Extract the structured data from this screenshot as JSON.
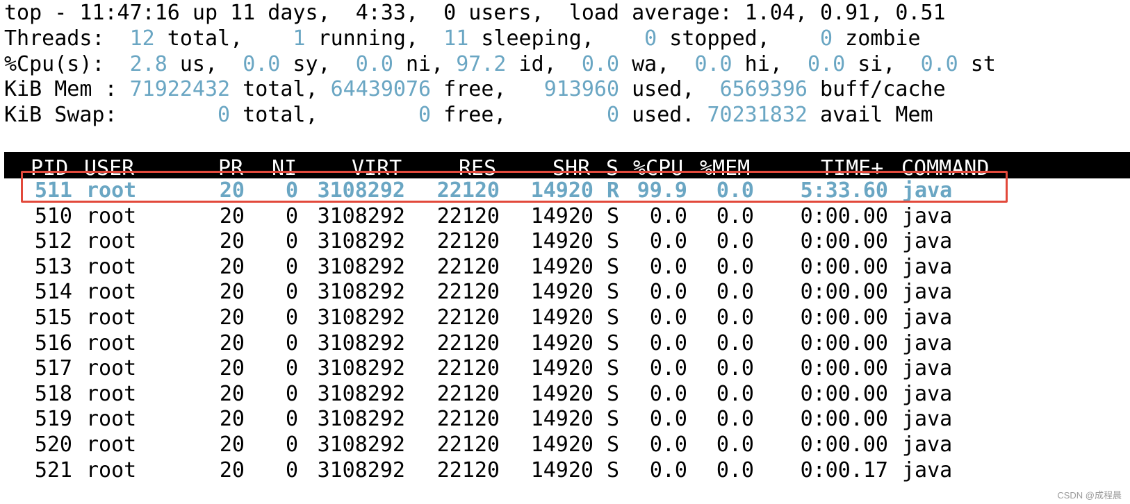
{
  "summary": {
    "top": "top - 11:47:16 up 11 days,  4:33,  0 users,  load average: 1.04, 0.91, 0.51",
    "threads": [
      {
        "t": "Threads: ",
        "c": false
      },
      {
        "t": " 12",
        "c": true
      },
      {
        "t": " total,  ",
        "c": false
      },
      {
        "t": "  1",
        "c": true
      },
      {
        "t": " running,  ",
        "c": false
      },
      {
        "t": "11",
        "c": true
      },
      {
        "t": " sleeping,  ",
        "c": false
      },
      {
        "t": "  0",
        "c": true
      },
      {
        "t": " stopped,  ",
        "c": false
      },
      {
        "t": "  0",
        "c": true
      },
      {
        "t": " zombie",
        "c": false
      }
    ],
    "cpu": [
      {
        "t": "%Cpu(s): ",
        "c": false
      },
      {
        "t": " 2.8",
        "c": true
      },
      {
        "t": " us,  ",
        "c": false
      },
      {
        "t": "0.0",
        "c": true
      },
      {
        "t": " sy,  ",
        "c": false
      },
      {
        "t": "0.0",
        "c": true
      },
      {
        "t": " ni, ",
        "c": false
      },
      {
        "t": "97.2",
        "c": true
      },
      {
        "t": " id,  ",
        "c": false
      },
      {
        "t": "0.0",
        "c": true
      },
      {
        "t": " wa,  ",
        "c": false
      },
      {
        "t": "0.0",
        "c": true
      },
      {
        "t": " hi,  ",
        "c": false
      },
      {
        "t": "0.0",
        "c": true
      },
      {
        "t": " si,  ",
        "c": false
      },
      {
        "t": "0.0",
        "c": true
      },
      {
        "t": " st",
        "c": false
      }
    ],
    "mem": [
      {
        "t": "KiB Mem : ",
        "c": false
      },
      {
        "t": "71922432",
        "c": true
      },
      {
        "t": " total, ",
        "c": false
      },
      {
        "t": "64439076",
        "c": true
      },
      {
        "t": " free,   ",
        "c": false
      },
      {
        "t": "913960",
        "c": true
      },
      {
        "t": " used,  ",
        "c": false
      },
      {
        "t": "6569396",
        "c": true
      },
      {
        "t": " buff/cache",
        "c": false
      }
    ],
    "swap": [
      {
        "t": "KiB Swap: ",
        "c": false
      },
      {
        "t": "       0",
        "c": true
      },
      {
        "t": " total,  ",
        "c": false
      },
      {
        "t": "      0",
        "c": true
      },
      {
        "t": " free,  ",
        "c": false
      },
      {
        "t": "      0",
        "c": true
      },
      {
        "t": " used. ",
        "c": false
      },
      {
        "t": "70231832",
        "c": true
      },
      {
        "t": " avail Mem",
        "c": false
      }
    ]
  },
  "columns": [
    "PID",
    "USER",
    "PR",
    "NI",
    "VIRT",
    "RES",
    "SHR",
    "S",
    "%CPU",
    "%MEM",
    "TIME+",
    "COMMAND"
  ],
  "rows": [
    {
      "pid": "511",
      "user": "root",
      "pr": "20",
      "ni": "0",
      "virt": "3108292",
      "res": "22120",
      "shr": "14920",
      "s": "R",
      "cpu": "99.9",
      "mem": "0.0",
      "time": "5:33.60",
      "cmd": "java",
      "active": true
    },
    {
      "pid": "510",
      "user": "root",
      "pr": "20",
      "ni": "0",
      "virt": "3108292",
      "res": "22120",
      "shr": "14920",
      "s": "S",
      "cpu": "0.0",
      "mem": "0.0",
      "time": "0:00.00",
      "cmd": "java"
    },
    {
      "pid": "512",
      "user": "root",
      "pr": "20",
      "ni": "0",
      "virt": "3108292",
      "res": "22120",
      "shr": "14920",
      "s": "S",
      "cpu": "0.0",
      "mem": "0.0",
      "time": "0:00.00",
      "cmd": "java"
    },
    {
      "pid": "513",
      "user": "root",
      "pr": "20",
      "ni": "0",
      "virt": "3108292",
      "res": "22120",
      "shr": "14920",
      "s": "S",
      "cpu": "0.0",
      "mem": "0.0",
      "time": "0:00.00",
      "cmd": "java"
    },
    {
      "pid": "514",
      "user": "root",
      "pr": "20",
      "ni": "0",
      "virt": "3108292",
      "res": "22120",
      "shr": "14920",
      "s": "S",
      "cpu": "0.0",
      "mem": "0.0",
      "time": "0:00.00",
      "cmd": "java"
    },
    {
      "pid": "515",
      "user": "root",
      "pr": "20",
      "ni": "0",
      "virt": "3108292",
      "res": "22120",
      "shr": "14920",
      "s": "S",
      "cpu": "0.0",
      "mem": "0.0",
      "time": "0:00.00",
      "cmd": "java"
    },
    {
      "pid": "516",
      "user": "root",
      "pr": "20",
      "ni": "0",
      "virt": "3108292",
      "res": "22120",
      "shr": "14920",
      "s": "S",
      "cpu": "0.0",
      "mem": "0.0",
      "time": "0:00.00",
      "cmd": "java"
    },
    {
      "pid": "517",
      "user": "root",
      "pr": "20",
      "ni": "0",
      "virt": "3108292",
      "res": "22120",
      "shr": "14920",
      "s": "S",
      "cpu": "0.0",
      "mem": "0.0",
      "time": "0:00.00",
      "cmd": "java"
    },
    {
      "pid": "518",
      "user": "root",
      "pr": "20",
      "ni": "0",
      "virt": "3108292",
      "res": "22120",
      "shr": "14920",
      "s": "S",
      "cpu": "0.0",
      "mem": "0.0",
      "time": "0:00.00",
      "cmd": "java"
    },
    {
      "pid": "519",
      "user": "root",
      "pr": "20",
      "ni": "0",
      "virt": "3108292",
      "res": "22120",
      "shr": "14920",
      "s": "S",
      "cpu": "0.0",
      "mem": "0.0",
      "time": "0:00.00",
      "cmd": "java"
    },
    {
      "pid": "520",
      "user": "root",
      "pr": "20",
      "ni": "0",
      "virt": "3108292",
      "res": "22120",
      "shr": "14920",
      "s": "S",
      "cpu": "0.0",
      "mem": "0.0",
      "time": "0:00.00",
      "cmd": "java"
    },
    {
      "pid": "521",
      "user": "root",
      "pr": "20",
      "ni": "0",
      "virt": "3108292",
      "res": "22120",
      "shr": "14920",
      "s": "S",
      "cpu": "0.0",
      "mem": "0.0",
      "time": "0:00.17",
      "cmd": "java"
    }
  ],
  "watermark": "CSDN @成程晨",
  "colors": {
    "value": "#6aa6c3",
    "highlight_box": "#e2493b",
    "header_bg": "#000000"
  }
}
